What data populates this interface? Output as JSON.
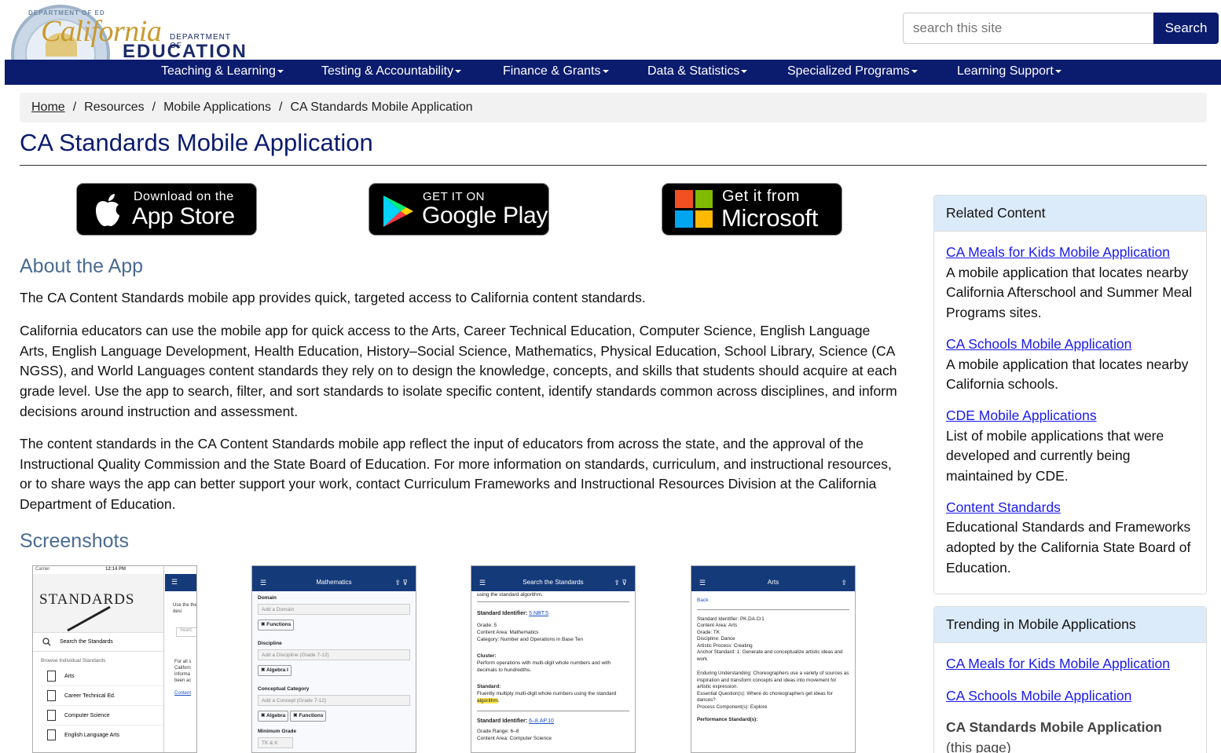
{
  "header": {
    "logo_word": "California",
    "logo_dept": "DEPARTMENT OF",
    "logo_edu": "EDUCATION",
    "seal_text": "DEPARTMENT OF ED",
    "search_placeholder": "search this site",
    "search_button": "Search"
  },
  "nav": {
    "items": [
      {
        "label": "Teaching & Learning"
      },
      {
        "label": "Testing & Accountability"
      },
      {
        "label": "Finance & Grants"
      },
      {
        "label": "Data & Statistics"
      },
      {
        "label": "Specialized Programs"
      },
      {
        "label": "Learning Support"
      }
    ]
  },
  "breadcrumb": {
    "items": [
      "Home",
      "Resources",
      "Mobile Applications",
      "CA Standards Mobile Application"
    ],
    "separator": "/"
  },
  "page": {
    "title": "CA Standards Mobile Application"
  },
  "badges": {
    "appstore": {
      "small": "Download on the",
      "big": "App Store"
    },
    "googleplay": {
      "small": "GET IT ON",
      "big": "Google Play"
    },
    "microsoft": {
      "small": "Get it from",
      "big": "Microsoft"
    }
  },
  "about": {
    "heading": "About the App",
    "p1": "The CA Content Standards mobile app provides quick, targeted access to California content standards.",
    "p2": "California educators can use the mobile app for quick access to the Arts, Career Technical Education, Computer Science, English Language Arts, English Language Development, Health Education, History–Social Science, Mathematics, Physical Education, School Library, Science (CA NGSS), and World Languages content standards they rely on to design the knowledge, concepts, and skills that students should acquire at each grade level. Use the app to search, filter, and sort standards to isolate specific content, identify standards common across disciplines, and inform decisions around instruction and assessment.",
    "p3": "The content standards in the CA Content Standards mobile app reflect the input of educators from across the state, and the approval of the Instructional Quality Commission and the State Board of Education. For more information on standards, curriculum, and instructional resources, or to share ways the app can better support your work, contact Curriculum Frameworks and Instructional Resources Division at the California Department of Education."
  },
  "screenshots": {
    "heading": "Screenshots",
    "shot1": {
      "status_carrier": "Carrier",
      "status_time": "12:14 PM",
      "logo": "STANDARDS",
      "search": "Search the Standards",
      "browse": "Browse Individual Standards",
      "items": [
        "Arts",
        "Career Technical Ed.",
        "Computer Science",
        "English Language Arts"
      ],
      "side_text1": "Use the the desi",
      "side_search": "Searc",
      "side_text2": "For all s Californ informa been ac",
      "side_link": "Content"
    },
    "shot2": {
      "title": "Mathematics",
      "domain_label": "Domain",
      "domain_placeholder": "Add a Domain",
      "domain_chip": "✖ Functions",
      "discipline_label": "Discipline",
      "discipline_placeholder": "Add a Discipline (Grade 7-12)",
      "discipline_chip": "✖ Algebra I",
      "concept_label": "Conceptual Category",
      "concept_placeholder": "Add a Concept (Grade 7-12)",
      "concept_chip1": "✖ Algebra",
      "concept_chip2": "✖ Functions",
      "min_grade_label": "Minimum Grade",
      "min_grade_value": "TK & K"
    },
    "shot3": {
      "title": "Search the Standards",
      "top_line": "using the standard algorithm.",
      "std1_label": "Standard Identifier:",
      "std1_id": "5.NBT.5",
      "std1_grade": "Grade: 5",
      "std1_area": "Content Area: Mathematics",
      "std1_cat": "Category: Number and Operations in Base Ten",
      "cluster_label": "Cluster:",
      "cluster_text": "Perform operations with multi-digit whole numbers and with decimals to hundredths.",
      "standard_label": "Standard:",
      "standard_text_a": "Fluently multiply multi-digit whole numbers using the standard",
      "standard_text_hl": "algorithm",
      "std2_label": "Standard Identifier:",
      "std2_id": "6–8.AP.10",
      "std2_grade": "Grade Range: 6–8",
      "std2_area": "Content Area: Computer Science"
    },
    "shot4": {
      "title": "Arts",
      "back": "Back",
      "lines": [
        "Standard Identifier: PK.DA.Cr1",
        "Content Area: Arts",
        "Grade: TK",
        "Discipline: Dance",
        "Artistic Process: Creating",
        "Anchor Standard: 1: Generate and conceptualize artistic ideas and work"
      ],
      "enduring": "Enduring Understanding: Choreographers use a variety of sources as inspiration and transform concepts and ideas into movement for artistic expression.",
      "essential": "Essential Question(s): Where do choreographers get ideas for dances?",
      "process": "Process Component(s): Explore",
      "perf": "Performance Standard(s):"
    }
  },
  "sidebar": {
    "related": {
      "heading": "Related Content",
      "items": [
        {
          "link": "CA Meals for Kids Mobile Application",
          "desc": "A mobile application that locates nearby California Afterschool and Summer Meal Programs sites."
        },
        {
          "link": "CA Schools Mobile Application",
          "desc": "A mobile application that locates nearby California schools."
        },
        {
          "link": "CDE Mobile Applications",
          "desc": "List of mobile applications that were developed and currently being maintained by CDE."
        },
        {
          "link": "Content Standards",
          "desc": "Educational Standards and Frameworks adopted by the California State Board of Education."
        }
      ]
    },
    "trending": {
      "heading": "Trending in Mobile Applications",
      "links": [
        "CA Meals for Kids Mobile Application",
        "CA Schools Mobile Application"
      ],
      "current": "CA Standards Mobile Application",
      "current_note": "(this page)"
    }
  },
  "colors": {
    "nav_bg": "#0b1b6e",
    "title": "#0b1b6e",
    "heading": "#4a6b93",
    "link": "#1a1aee",
    "card_head": "#dcebfa"
  }
}
